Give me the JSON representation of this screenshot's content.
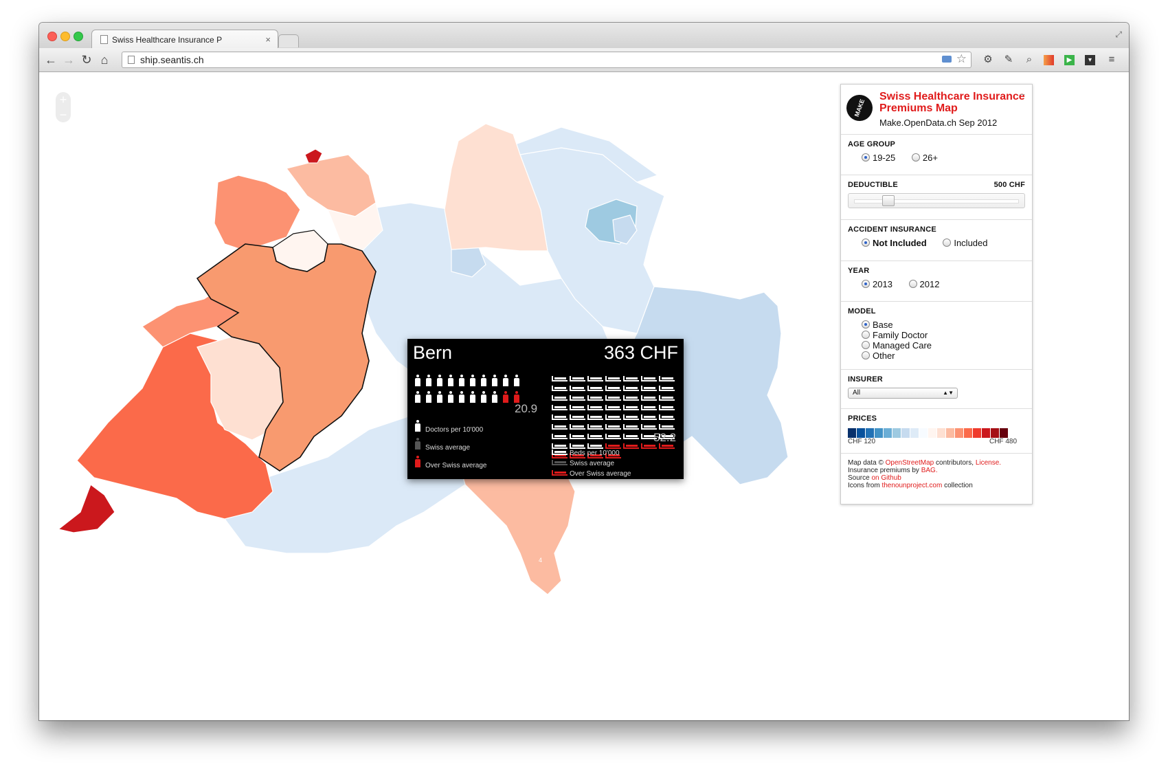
{
  "browser": {
    "tab_title": "Swiss Healthcare Insurance P",
    "url": "ship.seantis.ch"
  },
  "map": {
    "zoom_in": "+",
    "zoom_out": "−",
    "ticino_label": "4"
  },
  "tooltip": {
    "canton": "Bern",
    "price": "363 CHF",
    "doctors_value": "20.9",
    "doctors_legend": [
      "Doctors per 10'000",
      "Swiss average",
      "Over Swiss average"
    ],
    "beds_value": "52.2",
    "beds_legend": [
      "Beds per 10'000",
      "Swiss average",
      "Over Swiss average"
    ],
    "doctor_icons_white": 18,
    "doctor_icons_red": 2,
    "bed_icons_white": 52,
    "bed_icons_red": 8
  },
  "panel": {
    "logo_text": "MAKE",
    "title": "Swiss Healthcare Insurance Premiums Map",
    "subtitle": "Make.OpenData.ch Sep 2012",
    "collapse": "−",
    "age_group": {
      "label": "AGE GROUP",
      "options": [
        "19-25",
        "26+"
      ],
      "selected": "19-25"
    },
    "deductible": {
      "label": "DEDUCTIBLE",
      "value": "500 CHF",
      "fraction": 0.16
    },
    "accident": {
      "label": "ACCIDENT INSURANCE",
      "options": [
        "Not Included",
        "Included"
      ],
      "selected": "Not Included"
    },
    "year": {
      "label": "YEAR",
      "options": [
        "2013",
        "2012"
      ],
      "selected": "2013"
    },
    "model": {
      "label": "MODEL",
      "options": [
        "Base",
        "Family Doctor",
        "Managed Care",
        "Other"
      ],
      "selected": "Base"
    },
    "insurer": {
      "label": "INSURER",
      "value": "All"
    },
    "prices": {
      "label": "PRICES",
      "min": "CHF 120",
      "max": "CHF 480",
      "colors": [
        "#08306b",
        "#08519c",
        "#2171b5",
        "#4292c6",
        "#6baed6",
        "#9ecae1",
        "#c6dbef",
        "#deebf7",
        "#f7fbff",
        "#fff5f0",
        "#fee0d2",
        "#fcbba1",
        "#fc9272",
        "#fb6a4a",
        "#ef3b2c",
        "#cb181d",
        "#a50f15",
        "#67000d"
      ]
    },
    "credits": {
      "l1a": "Map data © ",
      "l1b": "OpenStreetMap",
      "l1c": " contributors, ",
      "l1d": "License.",
      "l2a": "Insurance premiums by ",
      "l2b": "BAG.",
      "l3a": "Source ",
      "l3b": "on Github",
      "l4a": "Icons from ",
      "l4b": "thenounproject.com",
      "l4c": " collection"
    }
  },
  "colors": {
    "accent_red": "#e01b1b",
    "bern_fill": "#f89a6f",
    "light_blue": "#dbe9f7"
  }
}
